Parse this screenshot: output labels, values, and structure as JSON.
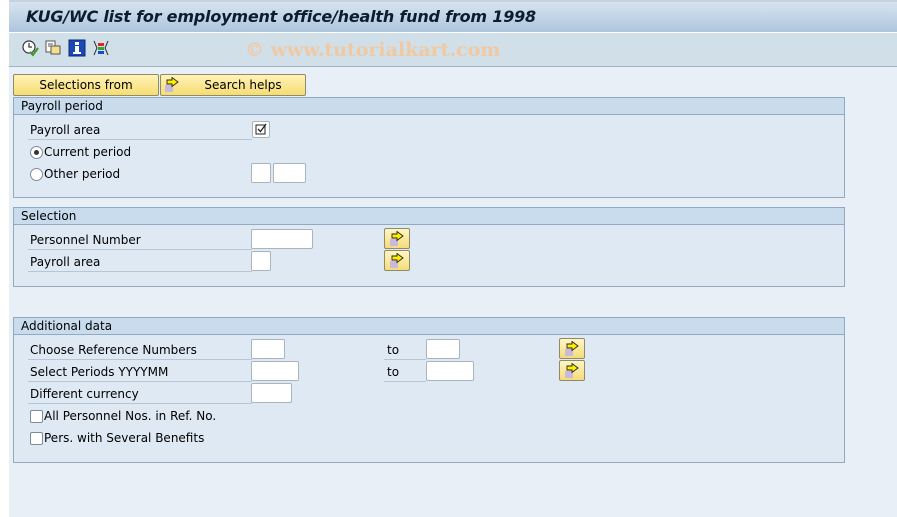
{
  "window": {
    "title": "KUG/WC list for employment office/health fund from 1998",
    "watermark": "© www.tutorialkart.com"
  },
  "toolbar": {
    "icons": [
      "execute-icon",
      "get-variant-icon",
      "program-info-icon",
      "selection-options-icon"
    ]
  },
  "buttons": {
    "selections_from": "Selections from",
    "search_helps": "Search helps"
  },
  "payroll_period": {
    "header": "Payroll period",
    "payroll_area_label": "Payroll area",
    "payroll_area_checked": true,
    "payroll_area_mark": "☑",
    "current_period_label": "Current period",
    "current_period_selected": true,
    "other_period_label": "Other period",
    "other_period_selected": false,
    "other_period_value1": "",
    "other_period_value2": ""
  },
  "selection": {
    "header": "Selection",
    "personnel_number_label": "Personnel Number",
    "personnel_number_value": "",
    "payroll_area_label": "Payroll area",
    "payroll_area_value": ""
  },
  "additional_data": {
    "header": "Additional data",
    "ref_numbers_label": "Choose Reference Numbers",
    "ref_numbers_from": "",
    "ref_numbers_to_label": "to",
    "ref_numbers_to": "",
    "periods_label": "Select Periods YYYYMM",
    "periods_from": "",
    "periods_to_label": "to",
    "periods_to": "",
    "currency_label": "Different currency",
    "currency_value": "",
    "all_personnel_label": "All Personnel Nos. in Ref. No.",
    "all_personnel_checked": false,
    "several_benefits_label": "Pers. with Several Benefits",
    "several_benefits_checked": false
  }
}
